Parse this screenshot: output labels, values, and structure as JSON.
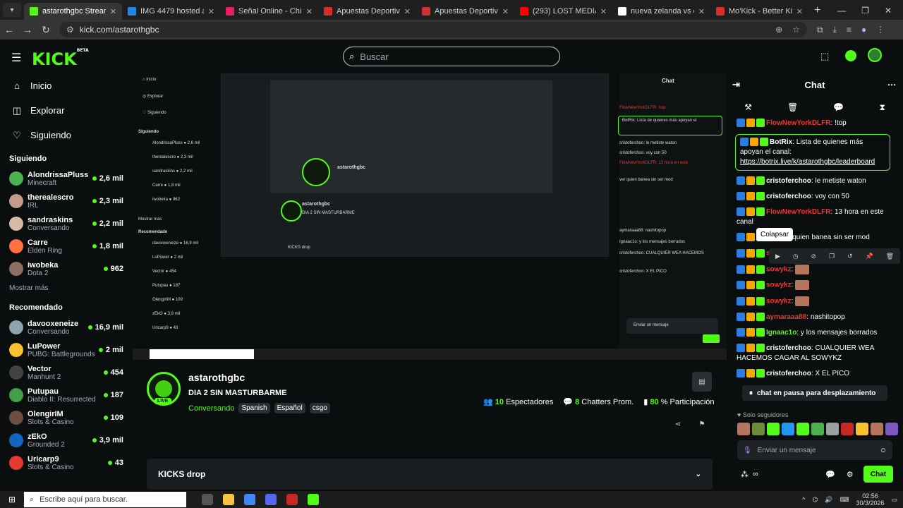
{
  "browser": {
    "tabs": [
      {
        "label": "astarothgbc Stream - Wa",
        "color": "#53fc18",
        "active": true
      },
      {
        "label": "IMG 4479 hosted at ImgB",
        "color": "#1e88e5",
        "active": false
      },
      {
        "label": "Señal Online - Chilevisión",
        "color": "#e91e63",
        "active": false
      },
      {
        "label": "Apuestas Deportivas - Ap",
        "color": "#d32f2f",
        "active": false
      },
      {
        "label": "Apuestas Deportivas - Ap",
        "color": "#d32f2f",
        "active": false
      },
      {
        "label": "(293) LOST MEDIA SEPIK",
        "color": "#ff0000",
        "active": false
      },
      {
        "label": "nueva zelanda vs chile - B",
        "color": "#ffffff",
        "active": false
      },
      {
        "label": "Mo'Kick - Better Kick For",
        "color": "#d32f2f",
        "active": false
      }
    ],
    "url": "kick.com/astarothgbc"
  },
  "header": {
    "logo": "KICK",
    "logo_sup": "BETA",
    "search_placeholder": "Buscar"
  },
  "sidebar": {
    "nav": [
      {
        "label": "Inicio",
        "icon": "home-icon"
      },
      {
        "label": "Explorar",
        "icon": "compass-icon"
      },
      {
        "label": "Siguiendo",
        "icon": "heart-icon"
      }
    ],
    "following_title": "Siguiendo",
    "following": [
      {
        "name": "AlondrissaPluss",
        "category": "Minecraft",
        "viewers": "2,6 mil",
        "color": "#4caf50"
      },
      {
        "name": "therealescro",
        "category": "IRL",
        "viewers": "2,3 mil",
        "color": "#c49a8a"
      },
      {
        "name": "sandraskins",
        "category": "Conversando",
        "viewers": "2,2 mil",
        "color": "#d7b9a8"
      },
      {
        "name": "Carre",
        "category": "Elden Ring",
        "viewers": "1,8 mil",
        "color": "#ff7043"
      },
      {
        "name": "iwobeka",
        "category": "Dota 2",
        "viewers": "962",
        "color": "#8d6e63"
      }
    ],
    "show_more": "Mostrar más",
    "recommended_title": "Recomendado",
    "recommended": [
      {
        "name": "davooxeneize",
        "category": "Conversando",
        "viewers": "16,9 mil",
        "color": "#90a4ae"
      },
      {
        "name": "LuPower",
        "category": "PUBG: Battlegrounds",
        "viewers": "2 mil",
        "color": "#fbc02d"
      },
      {
        "name": "Vector",
        "category": "Manhunt 2",
        "viewers": "454",
        "color": "#424242"
      },
      {
        "name": "Putupau",
        "category": "Diablo II: Resurrected",
        "viewers": "187",
        "color": "#43a047"
      },
      {
        "name": "OlengirIM",
        "category": "Slots & Casino",
        "viewers": "109",
        "color": "#6d4c41"
      },
      {
        "name": "zEkO",
        "category": "Grounded 2",
        "viewers": "3,9 mil",
        "color": "#1565c0"
      },
      {
        "name": "Uricarp9",
        "category": "Slots & Casino",
        "viewers": "43",
        "color": "#e53935"
      }
    ]
  },
  "stream": {
    "channel": "astarothgbc",
    "title": "DIA 2 SIN MASTURBARME",
    "category": "Conversando",
    "tags": [
      "Spanish",
      "Español",
      "csgo"
    ],
    "live": "LIVE",
    "viewers_num": "10",
    "viewers_label": "Espectadores",
    "chatters_num": "8",
    "chatters_label": "Chatters Prom.",
    "participation_num": "80",
    "participation_label": "% Participación",
    "kicks_drop": "KICKS drop"
  },
  "chat": {
    "title": "Chat",
    "messages": [
      {
        "user": "FlowNewYorkDLFR",
        "text": "!top",
        "color": "#e53935"
      },
      {
        "user": "BotRix",
        "text": "Lista de quienes más apoyan el canal:",
        "link": "https://botrix.live/k/astarothgbc/leaderboard",
        "color": "#ffffff",
        "pinned": true
      },
      {
        "user": "cristoferchoo",
        "text": "le metiste waton",
        "color": "#ffffff"
      },
      {
        "user": "cristoferchoo",
        "text": "voy con 50",
        "color": "#ffffff"
      },
      {
        "user": "FlowNewYorkDLFR",
        "text": "13 hora en este canal",
        "color": "#e53935"
      },
      {
        "user": "Ign",
        "text": "ver quien banea sin ser mod",
        "color": "#ffffff"
      },
      {
        "user": "sowykz",
        "text": "",
        "color": "#e53935"
      },
      {
        "user": "sowykz",
        "text": "",
        "color": "#e53935"
      },
      {
        "user": "sowykz",
        "text": "",
        "color": "#e53935"
      },
      {
        "user": "sowykz",
        "text": "",
        "color": "#e53935"
      },
      {
        "user": "aymaraaa88",
        "text": "nashitopop",
        "color": "#e53935"
      },
      {
        "user": "Ignaac1o",
        "text": "y los mensajes borrados",
        "color": "#53fc18"
      },
      {
        "user": "cristoferchoo",
        "text": "CUALQUIER WEA HACEMOS CAGAR AL SOWYKZ",
        "color": "#ffffff"
      },
      {
        "user": "cristoferchoo",
        "text": "X EL PICO",
        "color": "#ffffff"
      }
    ],
    "tooltip": "Colapsar",
    "paused": "chat en pausa para desplazamiento",
    "followers_only": "Solo seguidores",
    "input_placeholder": "Enviar un mensaje",
    "send": "Chat"
  },
  "taskbar": {
    "search": "Escribe aquí para buscar.",
    "time": "02:56",
    "date": "30/3/2026"
  }
}
